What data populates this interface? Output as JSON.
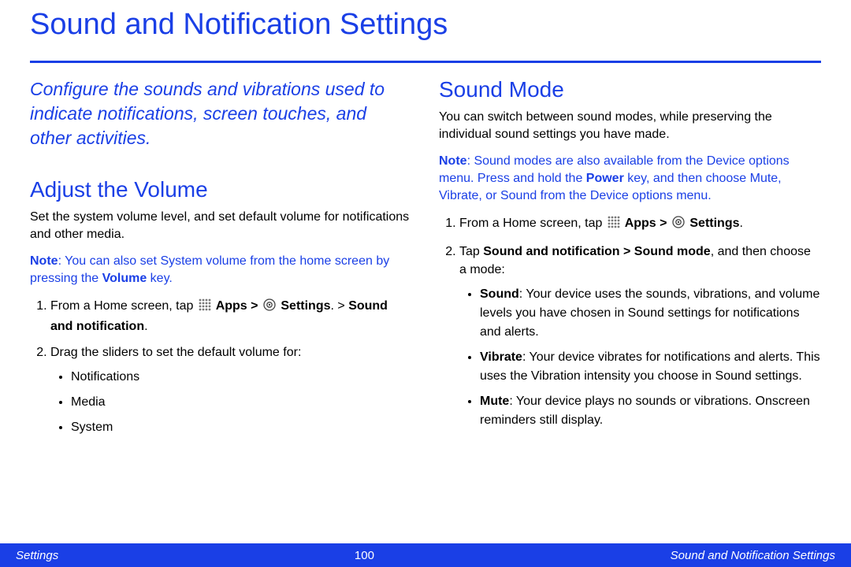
{
  "title": "Sound and Notification Settings",
  "intro": "Configure the sounds and vibrations used to indicate notifications, screen touches, and other activities.",
  "left": {
    "heading": "Adjust the Volume",
    "desc": "Set the system volume level, and set default volume for notifications and other media.",
    "note_label": "Note",
    "note_pre": ": You can also set System volume from the home screen by pressing the ",
    "note_bold": "Volume",
    "note_post": " key.",
    "step1_pre": "From a Home screen, tap ",
    "step1_apps": " Apps > ",
    "step1_settings": " Settings",
    "step1_post": ". > ",
    "step1_bold2": "Sound and notification",
    "step1_end": ".",
    "step2": "Drag the sliders to set the default volume for:",
    "bullets": [
      "Notifications",
      "Media",
      "System"
    ]
  },
  "right": {
    "heading": "Sound Mode",
    "desc": "You can switch between sound modes, while preserving the individual sound settings you have made.",
    "note_label": "Note",
    "note_pre": ": Sound modes are also available from the Device options menu. Press and hold the ",
    "note_bold": "Power",
    "note_post": " key, and then choose Mute, Vibrate, or Sound from the Device options menu.",
    "step1_pre": "From a Home screen, tap ",
    "step1_apps": " Apps > ",
    "step1_settings": " Settings",
    "step1_end": ".",
    "step2_pre": "Tap ",
    "step2_bold": "Sound and notification > Sound mode",
    "step2_post": ", and then choose a mode:",
    "modes": [
      {
        "name": "Sound",
        "desc": ": Your device uses the sounds, vibrations, and volume levels you have chosen in Sound settings for notifications and alerts."
      },
      {
        "name": "Vibrate",
        "desc": ": Your device vibrates for notifications and alerts. This uses the Vibration intensity you choose in Sound settings."
      },
      {
        "name": "Mute",
        "desc": ": Your device plays no sounds or vibrations. Onscreen reminders still display."
      }
    ]
  },
  "footer": {
    "left": "Settings",
    "center": "100",
    "right": "Sound and Notification Settings"
  }
}
